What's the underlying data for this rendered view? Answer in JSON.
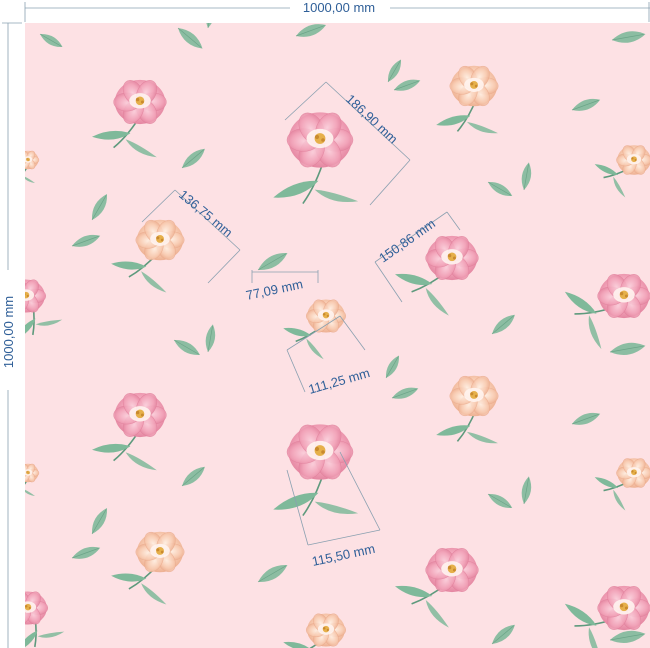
{
  "dimensions": {
    "width_label": "1000,00 mm",
    "height_label": "1000,00 mm"
  },
  "measurements": [
    {
      "id": "large-rose-top",
      "label": "186,90 mm"
    },
    {
      "id": "peach-rose-left",
      "label": "136,75 mm"
    },
    {
      "id": "leaf-small",
      "label": "77,09 mm"
    },
    {
      "id": "pink-rose-right",
      "label": "150,86 mm"
    },
    {
      "id": "peach-rose-center",
      "label": "111,25 mm"
    },
    {
      "id": "large-rose-bottom",
      "label": "115,50 mm"
    }
  ],
  "colors": {
    "background": "#fde1e4",
    "pink_rose": "#f3a6bb",
    "pink_rose_dark": "#e07e9a",
    "peach_rose": "#f9cdb4",
    "peach_rose_dark": "#eaa98a",
    "leaf": "#7fb99a",
    "leaf_dark": "#5e9a7d",
    "dimension_text": "#2f5f98",
    "dimension_line": "#8aa0b0"
  },
  "motifs": {
    "pink_rose_icon": "pink-rose-icon",
    "peach_rose_icon": "peach-rose-icon",
    "leaf_icon": "leaf-icon"
  }
}
